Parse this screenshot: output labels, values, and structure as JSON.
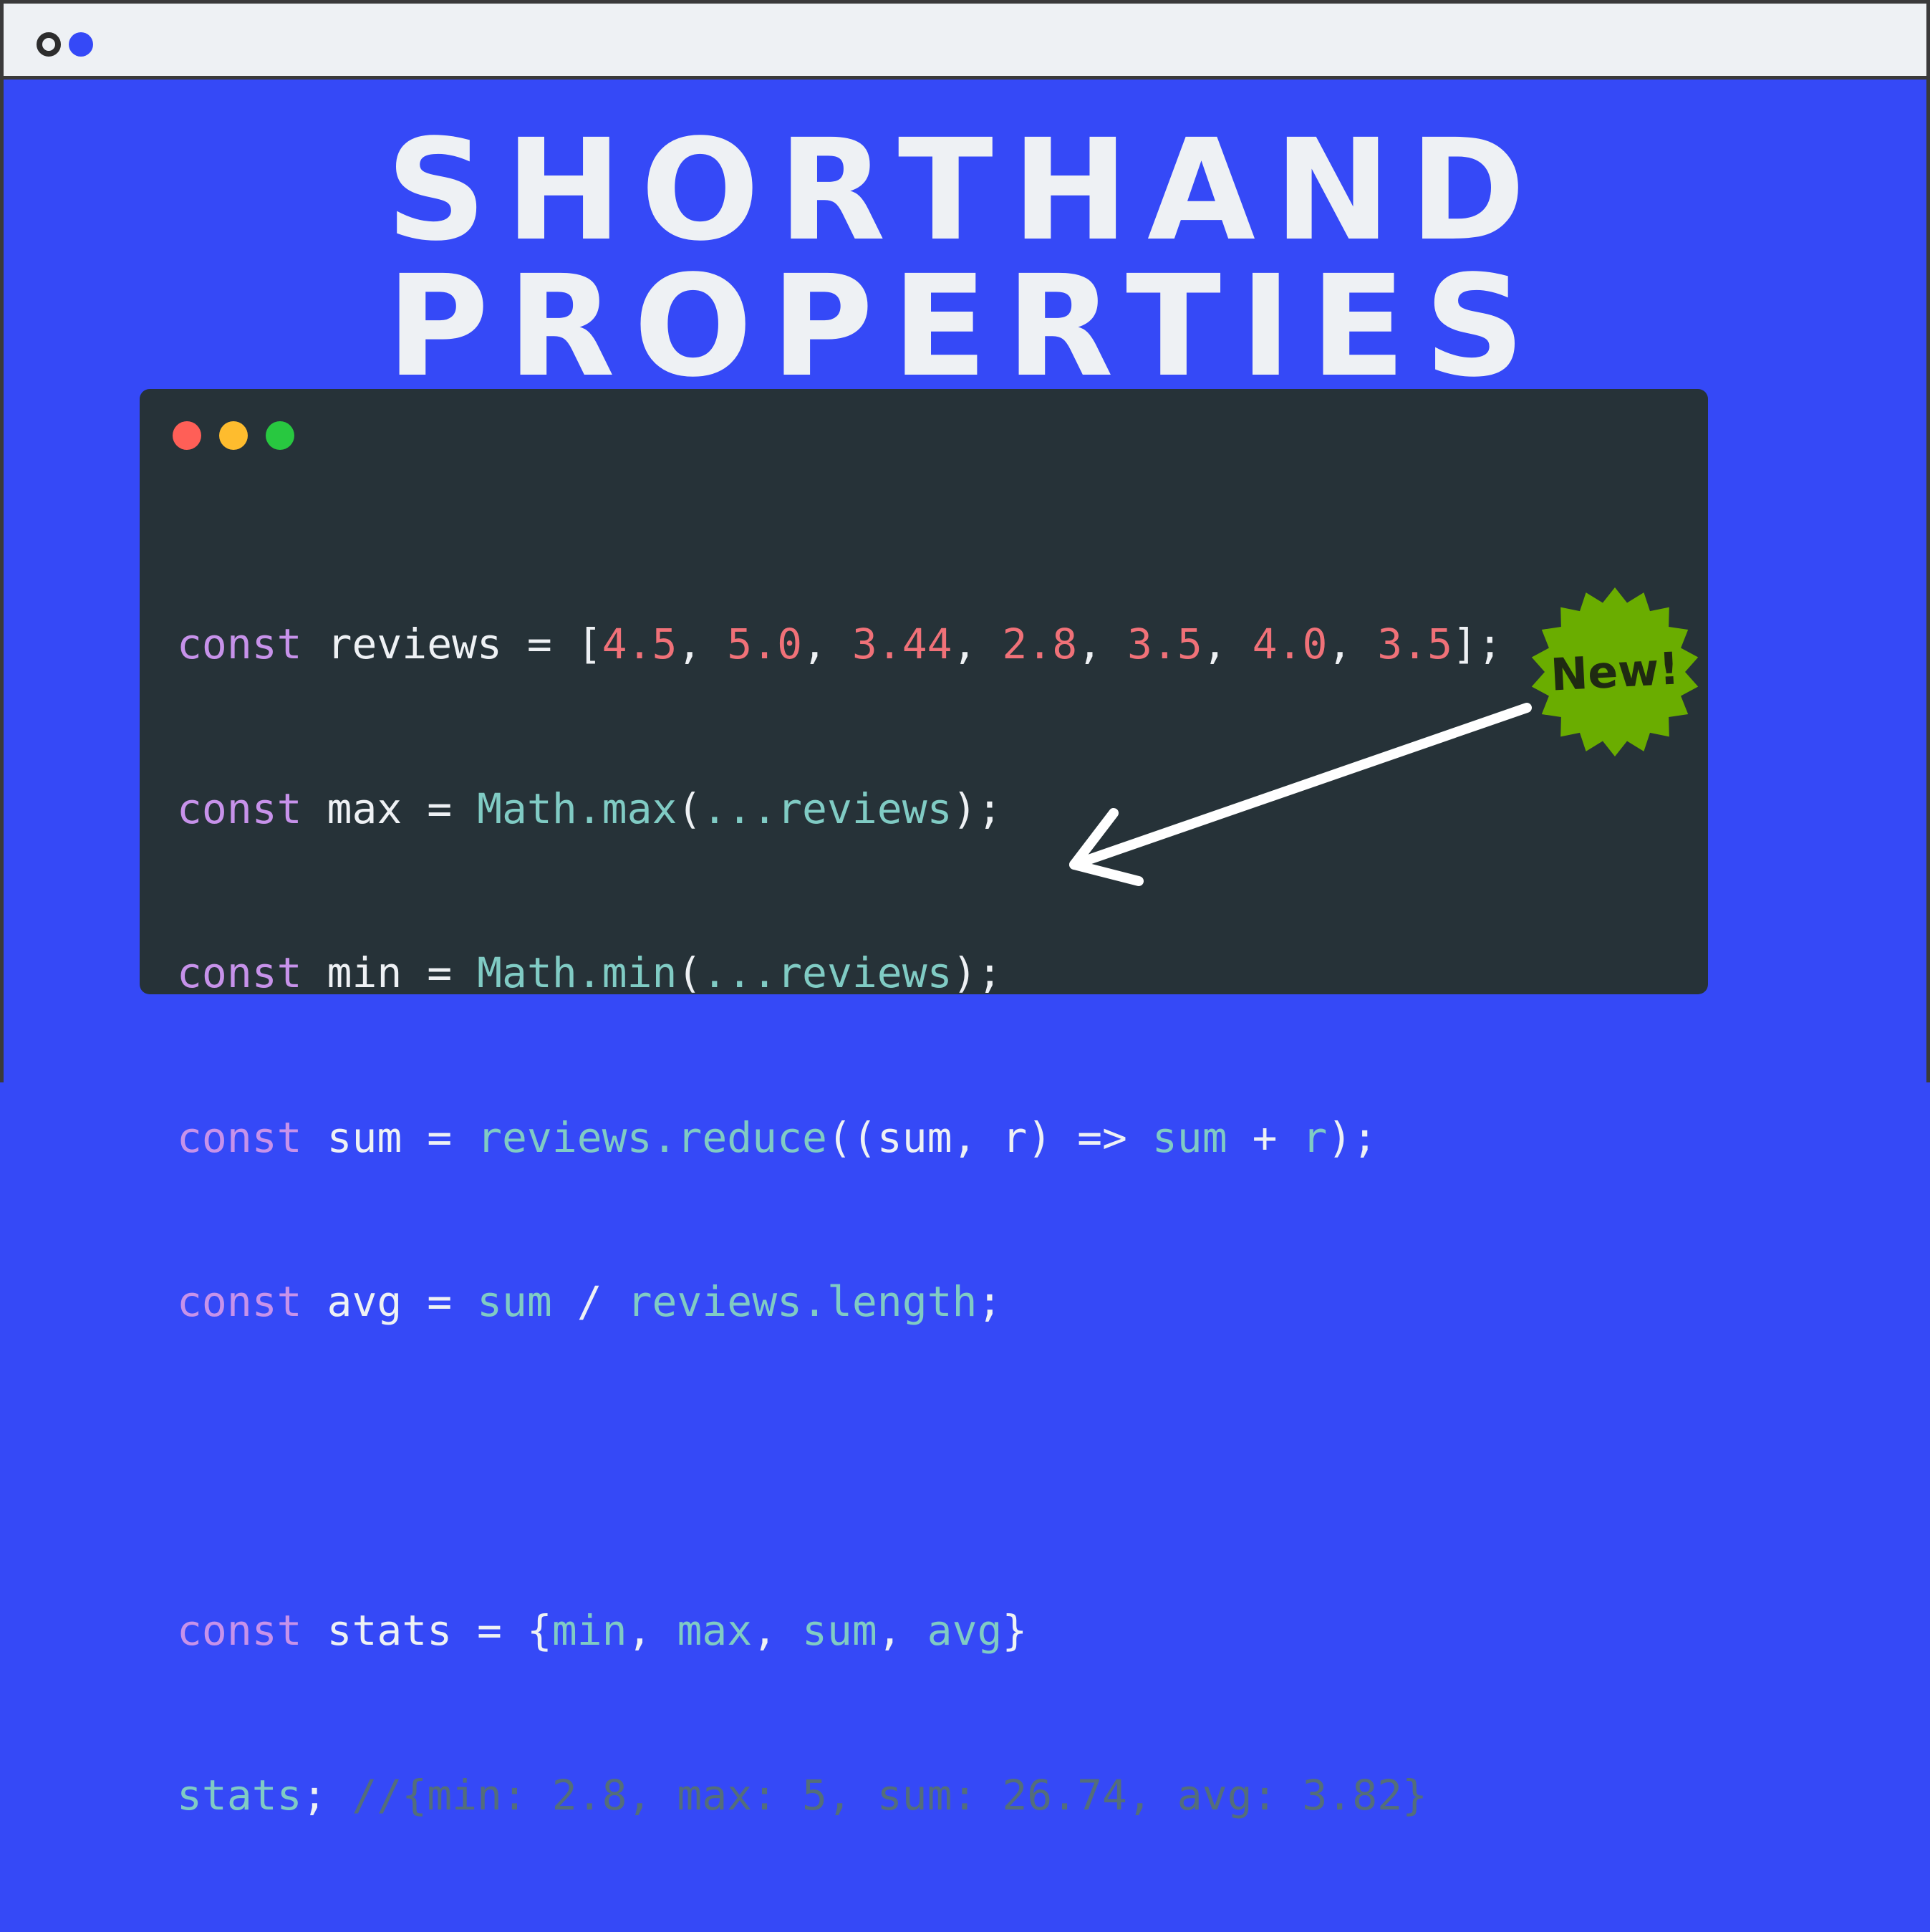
{
  "title": {
    "line1": "SHORTHAND",
    "line2": "PROPERTIES"
  },
  "badge": {
    "label": "New!",
    "color": "#6aad00"
  },
  "colors": {
    "background": "#3549f7",
    "editor": "#263238",
    "keyword": "#c792ea",
    "number": "#f07178",
    "identifier": "#80cbc4",
    "comment": "#546e7a"
  },
  "code": {
    "keyword": "const",
    "line1": {
      "name": "reviews",
      "op": " = [",
      "values": [
        "4.5",
        "5.0",
        "3.44",
        "2.8",
        "3.5",
        "4.0",
        "3.5"
      ],
      "end": "];"
    },
    "line2": {
      "name": "max",
      "op": " = ",
      "call": "Math.max",
      "args": "...reviews",
      "end": ");"
    },
    "line3": {
      "name": "min",
      "op": " = ",
      "call": "Math.min",
      "args": "...reviews",
      "end": ");"
    },
    "line4": {
      "name": "sum",
      "op": " = ",
      "call": "reviews.reduce",
      "params": "((sum, r) => ",
      "body_a": "sum",
      "plus": " + ",
      "body_b": "r",
      "end": ");"
    },
    "line5": {
      "name": "avg",
      "op": " = ",
      "a": "sum",
      "div": " / ",
      "b": "reviews.length",
      "end": ";"
    },
    "line6": {
      "name": "stats",
      "op": " = {",
      "props": [
        "min",
        "max",
        "sum",
        "avg"
      ],
      "end": "}"
    },
    "line7": {
      "name": "stats",
      "end": "; ",
      "comment": "//{min: 2.8, max: 5, sum: 26.74, avg: 3.82}"
    }
  }
}
